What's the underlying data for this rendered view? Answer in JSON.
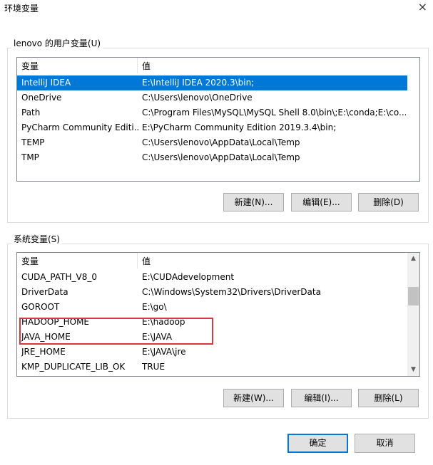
{
  "window": {
    "title": "环境变量",
    "close_glyph": "×"
  },
  "user_vars": {
    "group_label": "lenovo 的用户变量(U)",
    "columns": [
      "变量",
      "值"
    ],
    "rows": [
      {
        "name": "IntelliJ IDEA",
        "value": "E:\\IntelliJ IDEA 2020.3\\bin;"
      },
      {
        "name": "OneDrive",
        "value": "C:\\Users\\lenovo\\OneDrive"
      },
      {
        "name": "Path",
        "value": "C:\\Program Files\\MySQL\\MySQL Shell 8.0\\bin\\;E:\\conda;E:\\co..."
      },
      {
        "name": "PyCharm Community Editi...",
        "value": "E:\\PyCharm Community Edition 2019.3.4\\bin;"
      },
      {
        "name": "TEMP",
        "value": "C:\\Users\\lenovo\\AppData\\Local\\Temp"
      },
      {
        "name": "TMP",
        "value": "C:\\Users\\lenovo\\AppData\\Local\\Temp"
      }
    ],
    "buttons": {
      "new": "新建(N)...",
      "edit": "编辑(E)...",
      "delete": "删除(D)"
    }
  },
  "system_vars": {
    "group_label": "系统变量(S)",
    "columns": [
      "变量",
      "值"
    ],
    "rows": [
      {
        "name": "CUDA_PATH_V8_0",
        "value": "E:\\CUDAdevelopment"
      },
      {
        "name": "DriverData",
        "value": "C:\\Windows\\System32\\Drivers\\DriverData"
      },
      {
        "name": "GOROOT",
        "value": "E:\\go\\"
      },
      {
        "name": "HADOOP_HOME",
        "value": "E:\\hadoop"
      },
      {
        "name": "JAVA_HOME",
        "value": "E:\\JAVA"
      },
      {
        "name": "JRE_HOME",
        "value": "E:\\JAVA\\jre"
      },
      {
        "name": "KMP_DUPLICATE_LIB_OK",
        "value": "TRUE"
      }
    ],
    "buttons": {
      "new": "新建(W)...",
      "edit": "编辑(I)...",
      "delete": "删除(L)"
    }
  },
  "footer": {
    "ok": "确定",
    "cancel": "取消"
  },
  "colors": {
    "selection": "#0078d7",
    "highlight_box": "#d9363e"
  }
}
